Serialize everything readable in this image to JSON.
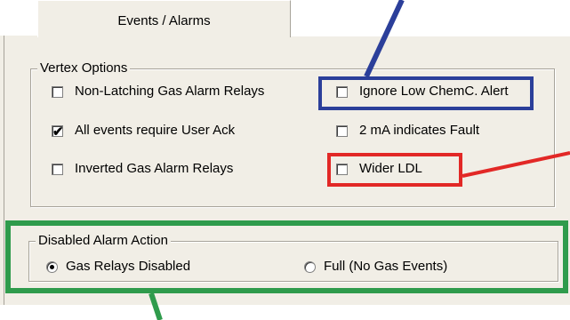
{
  "tab": {
    "label": "Events / Alarms"
  },
  "vertex_options": {
    "legend": "Vertex Options",
    "items": [
      {
        "label": "Non-Latching Gas Alarm Relays",
        "checked": false
      },
      {
        "label": "All events require User Ack",
        "checked": true
      },
      {
        "label": "Inverted Gas Alarm Relays",
        "checked": false
      },
      {
        "label": "Ignore Low ChemC. Alert",
        "checked": false
      },
      {
        "label": "2 mA indicates Fault",
        "checked": false
      },
      {
        "label": "Wider LDL",
        "checked": false
      }
    ]
  },
  "disabled_alarm_action": {
    "legend": "Disabled Alarm Action",
    "options": [
      {
        "label": "Gas Relays Disabled",
        "selected": true
      },
      {
        "label": "Full (No Gas Events)",
        "selected": false
      }
    ]
  },
  "check_glyph": "✔",
  "colors": {
    "panel_bg": "#f1eee6",
    "blue_highlight": "#2b3f9a",
    "red_highlight": "#e22826",
    "green_highlight": "#2f9b4c"
  }
}
